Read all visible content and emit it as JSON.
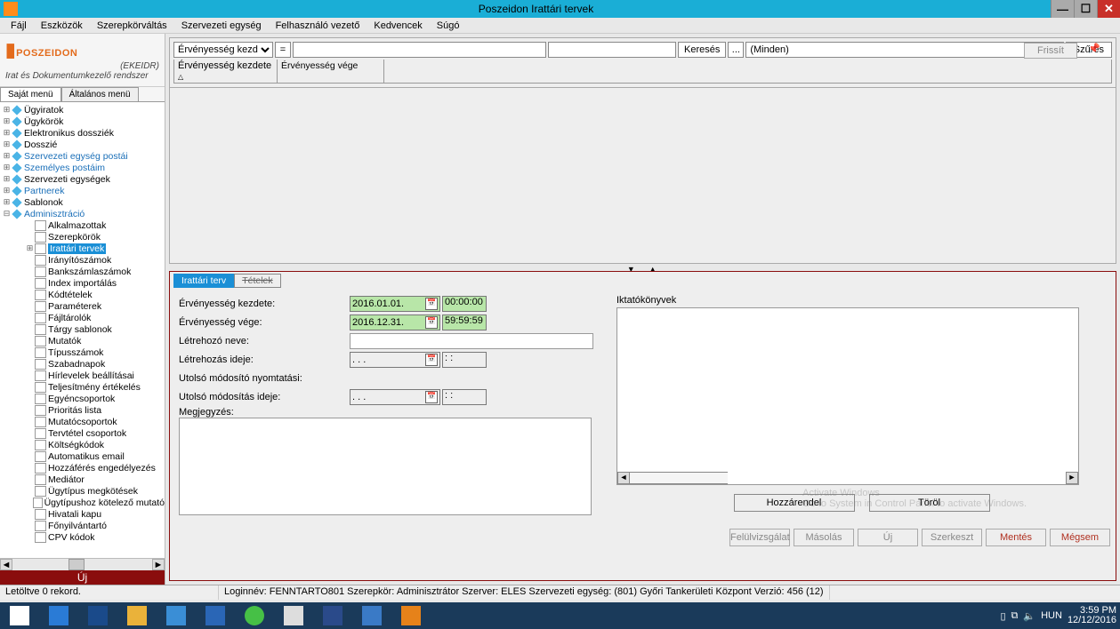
{
  "titlebar": {
    "title": "Poszeidon Irattári tervek"
  },
  "menubar": [
    "Fájl",
    "Eszközök",
    "Szerepkörváltás",
    "Szervezeti egység",
    "Felhasználó vezető",
    "Kedvencek",
    "Súgó"
  ],
  "logo": {
    "text": "POSZEIDON",
    "subtitle": "(EKEIDR)",
    "desc": "Irat és Dokumentumkezelő rendszer"
  },
  "sidebar_tabs": {
    "active": "Saját menü",
    "other": "Általános menü"
  },
  "tree": {
    "top": [
      {
        "label": "Ügyiratok"
      },
      {
        "label": "Ügykörök"
      },
      {
        "label": "Elektronikus dossziék"
      },
      {
        "label": "Dosszié"
      },
      {
        "label": "Szervezeti egység postái",
        "blue": true
      },
      {
        "label": "Személyes postáim",
        "blue": true
      },
      {
        "label": "Szervezeti egységek"
      },
      {
        "label": "Partnerek",
        "blue": true
      },
      {
        "label": "Sablonok"
      },
      {
        "label": "Adminisztráció",
        "blue": true,
        "expanded": true
      }
    ],
    "admin_children": [
      {
        "label": "Alkalmazottak"
      },
      {
        "label": "Szerepkörök"
      },
      {
        "label": "Irattári tervek",
        "selected": true
      },
      {
        "label": "Irányítószámok"
      },
      {
        "label": "Bankszámlaszámok"
      },
      {
        "label": "Index importálás"
      },
      {
        "label": "Kódtételek"
      },
      {
        "label": "Paraméterek"
      },
      {
        "label": "Fájltárolók"
      },
      {
        "label": "Tárgy sablonok"
      },
      {
        "label": "Mutatók"
      },
      {
        "label": "Típusszámok"
      },
      {
        "label": "Szabadnapok"
      },
      {
        "label": "Hírlevelek beállításai"
      },
      {
        "label": "Teljesítmény értékelés"
      },
      {
        "label": "Egyéncsoportok"
      },
      {
        "label": "Prioritás lista"
      },
      {
        "label": "Mutatócsoportok"
      },
      {
        "label": "Tervtétel csoportok"
      },
      {
        "label": "Költségkódok"
      },
      {
        "label": "Automatikus email"
      },
      {
        "label": "Hozzáférés engedélyezés"
      },
      {
        "label": "Mediátor"
      },
      {
        "label": "Ügytípus megkötések"
      },
      {
        "label": "Ügytípushoz kötelező mutató"
      },
      {
        "label": "Hivatali kapu"
      },
      {
        "label": "Főnyilvántartó"
      },
      {
        "label": "CPV kódok"
      }
    ]
  },
  "uj": "Új",
  "toolbar": {
    "frissit": "Frissít",
    "dropdown": "Érvényesség kezdete",
    "eq": "=",
    "keres": "Keresés",
    "ellipsis": "...",
    "minden": "(Minden)",
    "szures": "Szűrés",
    "col1": "Érvényesség kezdete",
    "col2": "Érvényesség vége"
  },
  "form_tabs": {
    "active": "Irattári terv",
    "other": "Tételek"
  },
  "form": {
    "labels": {
      "ek": "Érvényesség kezdete:",
      "ev": "Érvényesség vége:",
      "ln": "Létrehozó neve:",
      "li": "Létrehozás ideje:",
      "umn": "Utolsó módosító nyomtatási:",
      "umi": "Utolsó módosítás ideje:",
      "meg": "Megjegyzés:",
      "ikt": "Iktatókönyvek"
    },
    "values": {
      "ek_date": "2016.01.01.",
      "ek_time": "00:00:00",
      "ev_date": "2016.12.31.",
      "ev_time": "59:59:59",
      "li_date": ". . .",
      "li_time": ": :",
      "umi_date": ". . .",
      "umi_time": ": :"
    },
    "buttons": {
      "hozzarendel": "Hozzárendel",
      "torol": "Töröl"
    }
  },
  "bottom_buttons": [
    "Felülvizsgálat",
    "Másolás",
    "Új",
    "Szerkeszt",
    "Mentés",
    "Mégsem"
  ],
  "watermark": {
    "line1": "Activate Windows",
    "line2": "Go to System in Control Panel to activate Windows."
  },
  "statusbar": {
    "rec": "Letöltve 0 rekord.",
    "info": "Loginnév: FENNTARTO801   Szerepkör: Adminisztrátor   Szerver: ELES   Szervezeti egység: (801) Győri Tankerületi Központ   Verzió: 456 (12)"
  },
  "tray": {
    "lang": "HUN",
    "time": "3:59 PM",
    "date": "12/12/2016"
  }
}
